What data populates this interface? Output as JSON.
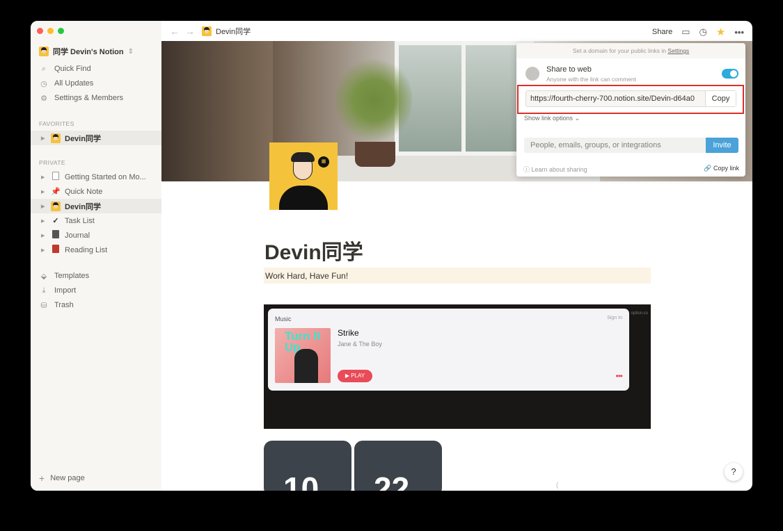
{
  "window": {
    "title": "Devin同学"
  },
  "sidebar": {
    "workspace": "同学 Devin's Notion",
    "nav": [
      {
        "label": "Quick Find",
        "icon": "search-icon"
      },
      {
        "label": "All Updates",
        "icon": "clock-icon"
      },
      {
        "label": "Settings & Members",
        "icon": "gear-icon"
      }
    ],
    "favorites_label": "FAVORITES",
    "favorites": [
      {
        "label": "Devin同学",
        "icon": "avatar-icon"
      }
    ],
    "private_label": "PRIVATE",
    "private": [
      {
        "label": "Getting Started on Mo...",
        "icon": "document-icon"
      },
      {
        "label": "Quick Note",
        "icon": "pushpin-icon"
      },
      {
        "label": "Devin同学",
        "icon": "avatar-icon"
      },
      {
        "label": "Task List",
        "icon": "checkmark-icon"
      },
      {
        "label": "Journal",
        "icon": "notebook-icon"
      },
      {
        "label": "Reading List",
        "icon": "book-icon"
      }
    ],
    "tools": [
      {
        "label": "Templates",
        "icon": "shapes-icon"
      },
      {
        "label": "Import",
        "icon": "download-icon"
      },
      {
        "label": "Trash",
        "icon": "trash-icon"
      }
    ],
    "new_page": "New page"
  },
  "topbar": {
    "page_title": "Devin同学",
    "share_label": "Share"
  },
  "page": {
    "title": "Devin同学",
    "callout": "Work Hard, Have Fun!",
    "clock_digits": [
      "10",
      "22"
    ]
  },
  "music": {
    "brand": "Music",
    "sign_in": "Sign In",
    "watermark": "option.co",
    "cover_text": "Turn It Up",
    "song": "Strike",
    "artist": "Jane & The Boy",
    "play_label": "▶ PLAY"
  },
  "share_popup": {
    "top_text": "Set a domain for your public links in",
    "top_link": "Settings",
    "share_to_web": "Share to web",
    "share_sub": "Anyone with the link can comment",
    "toggle_on": true,
    "url": "https://fourth-cherry-700.notion.site/Devin-d64a0",
    "copy_label": "Copy",
    "show_link_options": "Show link options",
    "invite_placeholder": "People, emails, groups, or integrations",
    "invite_label": "Invite",
    "learn": "Learn about sharing",
    "copy_link": "Copy link"
  },
  "colors": {
    "accent": "#2eaadc",
    "highlight_border": "#d9302b",
    "callout_bg": "#fbf3e4"
  }
}
